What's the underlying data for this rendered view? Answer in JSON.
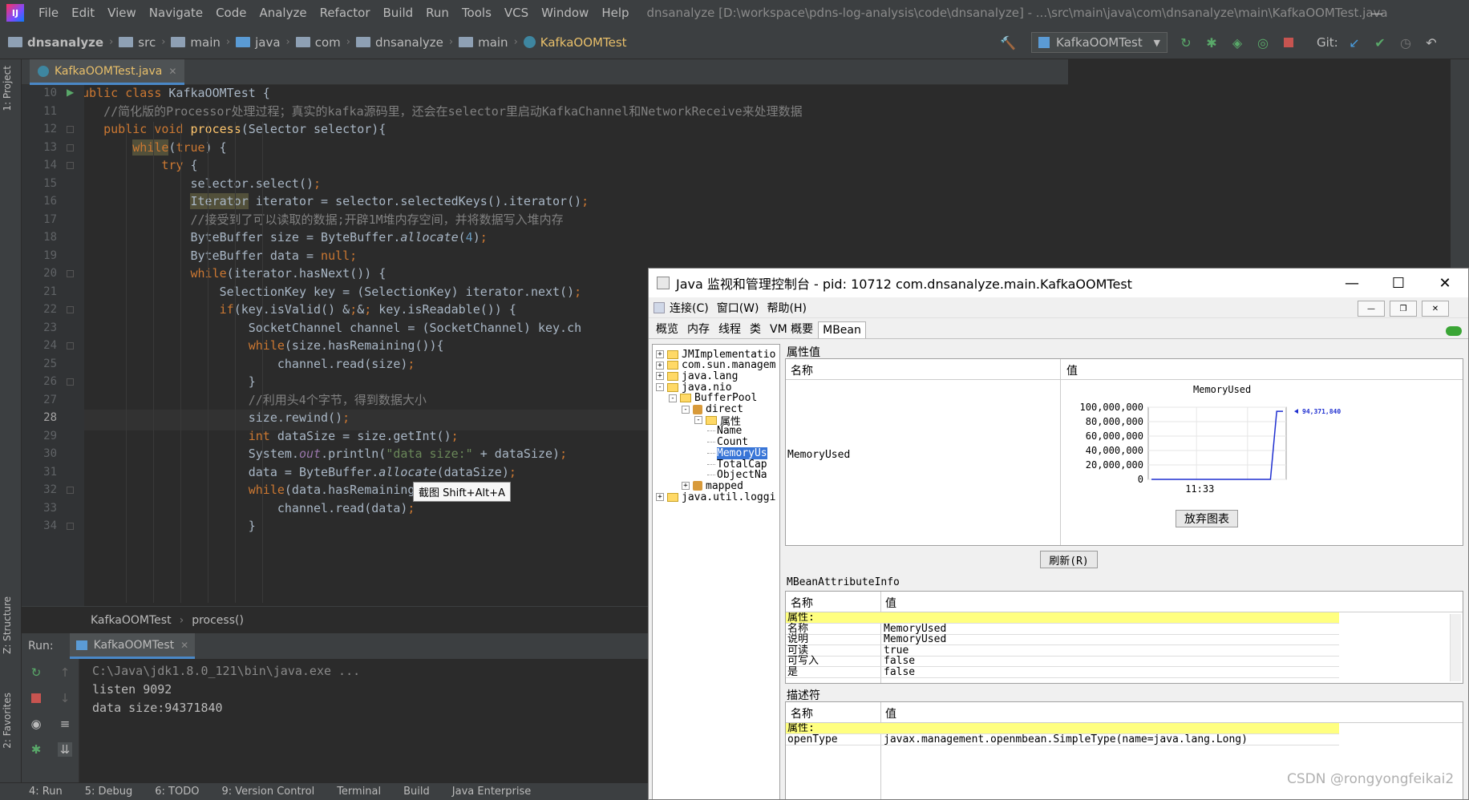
{
  "menubar": {
    "items": [
      "File",
      "Edit",
      "View",
      "Navigate",
      "Code",
      "Analyze",
      "Refactor",
      "Build",
      "Run",
      "Tools",
      "VCS",
      "Window",
      "Help"
    ],
    "window_title": "dnsanalyze [D:\\workspace\\pdns-log-analysis\\code\\dnsanalyze] - ...\\src\\main\\java\\com\\dnsanalyze\\main\\KafkaOOMTest.java"
  },
  "navbar": {
    "crumbs": [
      "dnsanalyze",
      "src",
      "main",
      "java",
      "com",
      "dnsanalyze",
      "main",
      "KafkaOOMTest"
    ],
    "run_config": "KafkaOOMTest",
    "git_label": "Git:"
  },
  "sidebar": {
    "project": "1: Project",
    "structure": "Z: Structure",
    "favorites": "2: Favorites"
  },
  "editor": {
    "tab_label": "KafkaOOMTest.java",
    "lines": [
      {
        "n": "10",
        "code": "public class KafkaOOMTest {"
      },
      {
        "n": "11",
        "code": "    //简化版的Processor处理过程；真实的kafka源码里，还会在selector里启动KafkaChannel和NetworkReceive来处理数据"
      },
      {
        "n": "12",
        "code": "    public void process(Selector selector){"
      },
      {
        "n": "13",
        "code": "        while(true) {"
      },
      {
        "n": "14",
        "code": "            try {"
      },
      {
        "n": "15",
        "code": "                selector.select();"
      },
      {
        "n": "16",
        "code": "                Iterator iterator = selector.selectedKeys().iterator();"
      },
      {
        "n": "17",
        "code": "                //接受到了可以读取的数据;开辟1M堆内存空间，并将数据写入堆内存"
      },
      {
        "n": "18",
        "code": "                ByteBuffer size = ByteBuffer.allocate(4);"
      },
      {
        "n": "19",
        "code": "                ByteBuffer data = null;"
      },
      {
        "n": "20",
        "code": "                while(iterator.hasNext()) {"
      },
      {
        "n": "21",
        "code": "                    SelectionKey key = (SelectionKey) iterator.next();"
      },
      {
        "n": "22",
        "code": "                    if(key.isValid() && key.isReadable()) {"
      },
      {
        "n": "23",
        "code": "                        SocketChannel channel = (SocketChannel) key.ch"
      },
      {
        "n": "24",
        "code": "                        while(size.hasRemaining()){"
      },
      {
        "n": "25",
        "code": "                            channel.read(size);"
      },
      {
        "n": "26",
        "code": "                        }"
      },
      {
        "n": "27",
        "code": "                        //利用头4个字节，得到数据大小"
      },
      {
        "n": "28",
        "code": "                        size.rewind();"
      },
      {
        "n": "29",
        "code": "                        int dataSize = size.getInt();"
      },
      {
        "n": "30",
        "code": "                        System.out.println(\"data size:\" + dataSize);"
      },
      {
        "n": "31",
        "code": "                        data = ByteBuffer.allocate(dataSize);"
      },
      {
        "n": "32",
        "code": "                        while(data.hasRemaining())"
      },
      {
        "n": "33",
        "code": "                            channel.read(data);"
      },
      {
        "n": "34",
        "code": "                        }"
      }
    ],
    "tooltip": "截图 Shift+Alt+A",
    "breadcrumb": [
      "KafkaOOMTest",
      "process()"
    ]
  },
  "run": {
    "label": "Run:",
    "tab": "KafkaOOMTest",
    "output": [
      "C:\\Java\\jdk1.8.0_121\\bin\\java.exe ...",
      "listen 9092",
      "data size:94371840"
    ]
  },
  "bottombar": [
    "4: Run",
    "5: Debug",
    "6: TODO",
    "9: Version Control",
    "Terminal",
    "Build",
    "Java Enterprise"
  ],
  "jconsole": {
    "title": "Java 监视和管理控制台 - pid: 10712 com.dnsanalyze.main.KafkaOOMTest",
    "menu": [
      "连接(C)",
      "窗口(W)",
      "帮助(H)"
    ],
    "tabs": [
      "概览",
      "内存",
      "线程",
      "类",
      "VM 概要",
      "MBean"
    ],
    "tree": [
      {
        "label": "JMImplementatio",
        "level": 0,
        "pm": "+",
        "kind": "folder"
      },
      {
        "label": "com.sun.managem",
        "level": 0,
        "pm": "+",
        "kind": "folder"
      },
      {
        "label": "java.lang",
        "level": 0,
        "pm": "+",
        "kind": "folder"
      },
      {
        "label": "java.nio",
        "level": 0,
        "pm": "-",
        "kind": "folder"
      },
      {
        "label": "BufferPool",
        "level": 1,
        "pm": "-",
        "kind": "folder"
      },
      {
        "label": "direct",
        "level": 2,
        "pm": "-",
        "kind": "bean"
      },
      {
        "label": "属性",
        "level": 3,
        "pm": "-",
        "kind": "folder"
      },
      {
        "label": "Name",
        "level": 4,
        "pm": "",
        "kind": "leaf"
      },
      {
        "label": "Count",
        "level": 4,
        "pm": "",
        "kind": "leaf"
      },
      {
        "label": "MemoryUs",
        "level": 4,
        "pm": "",
        "kind": "leaf",
        "selected": true
      },
      {
        "label": "TotalCap",
        "level": 4,
        "pm": "",
        "kind": "leaf"
      },
      {
        "label": "ObjectNa",
        "level": 4,
        "pm": "",
        "kind": "leaf"
      },
      {
        "label": "mapped",
        "level": 2,
        "pm": "+",
        "kind": "bean"
      },
      {
        "label": "java.util.loggi",
        "level": 0,
        "pm": "+",
        "kind": "folder"
      }
    ],
    "attr_section": "属性值",
    "col_name": "名称",
    "col_value": "值",
    "attr_name": "MemoryUsed",
    "chart_title": "MemoryUsed",
    "chart_current": "94,371,840",
    "discard_button": "放弃图表",
    "refresh_button": "刷新(R)",
    "info_section": "MBeanAttributeInfo",
    "info_rows": [
      {
        "k": "属性:",
        "v": "",
        "highlight": true
      },
      {
        "k": "名称",
        "v": "MemoryUsed"
      },
      {
        "k": "说明",
        "v": "MemoryUsed"
      },
      {
        "k": "可读",
        "v": "true"
      },
      {
        "k": "可写入",
        "v": "false"
      },
      {
        "k": "是",
        "v": "false"
      }
    ],
    "desc_section": "描述符",
    "desc_rows": [
      {
        "k": "属性:",
        "v": "",
        "highlight": true
      },
      {
        "k": "openType",
        "v": "javax.management.openmbean.SimpleType(name=java.lang.Long)"
      }
    ]
  },
  "chart_data": {
    "type": "line",
    "title": "MemoryUsed",
    "x_ticks": [
      "11:33"
    ],
    "y_ticks": [
      "100,000,000",
      "80,000,000",
      "60,000,000",
      "40,000,000",
      "20,000,000",
      "0"
    ],
    "ylim": [
      0,
      100000000
    ],
    "points": [
      0,
      0,
      0,
      0,
      0,
      0,
      0,
      0,
      0,
      0,
      0,
      0,
      0,
      0,
      0,
      0,
      0,
      0,
      0,
      0,
      94371840,
      94371840
    ],
    "latest_label": "94,371,840"
  },
  "watermark": "CSDN @rongyongfeikai2"
}
